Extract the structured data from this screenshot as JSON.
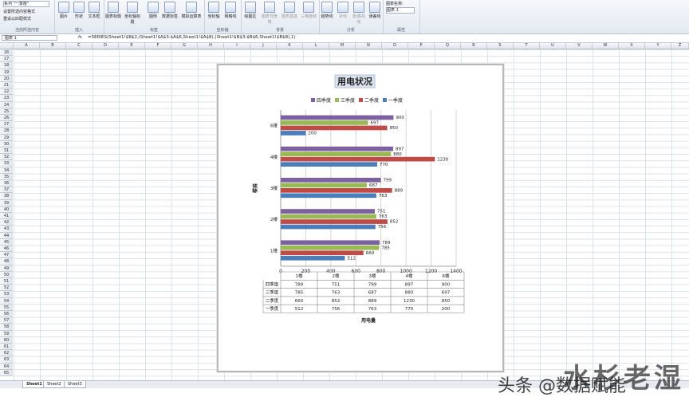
{
  "ribbon": {
    "series_selector": "系列 \"一季度\"",
    "format_selection": "设置所选内容格式",
    "reset_style": "重设以匹配样式",
    "group_current": "当前所选内容",
    "group_insert": "插入",
    "group_labels": "标签",
    "group_axes": "坐标轴",
    "group_background": "背景",
    "group_analysis": "分析",
    "group_properties": "属性",
    "buttons": [
      "图片",
      "形状",
      "文本框",
      "图表标题",
      "坐标轴标题",
      "图例",
      "数据标签",
      "模拟运算表",
      "坐标轴",
      "网格线",
      "绘图区",
      "图表背景墙",
      "图表基底",
      "三维旋转",
      "趋势线",
      "折线",
      "涨/跌柱线",
      "误差线"
    ],
    "chart_name_label": "图表名称:",
    "chart_name_value": "图表 1"
  },
  "formula_bar": {
    "name_box": "图表 1",
    "fx": "fx",
    "formula": "=SERIES(Sheet1!$B$2,(Sheet1!$A$3:$A$6,Sheet1!$A$8),(Sheet1!$B$3:$B$6,Sheet1!$B$8),1)"
  },
  "columns": [
    "A",
    "B",
    "C",
    "D",
    "E",
    "F",
    "G",
    "H",
    "I",
    "J",
    "K",
    "L",
    "M",
    "N",
    "O",
    "P",
    "Q",
    "R",
    "S",
    "T",
    "U",
    "V",
    "W",
    "X",
    "Y",
    "Z"
  ],
  "rows": [
    "16",
    "17",
    "18",
    "19",
    "20",
    "21",
    "22",
    "23",
    "24",
    "25",
    "26",
    "27",
    "28",
    "29",
    "30",
    "31",
    "32",
    "33",
    "34",
    "35",
    "36",
    "37",
    "38",
    "39",
    "40",
    "41",
    "42",
    "43",
    "44",
    "45",
    "46",
    "47",
    "48",
    "49",
    "50",
    "51",
    "52",
    "53",
    "54",
    "55",
    "56",
    "57",
    "58",
    "59",
    "60",
    "61",
    "62",
    "63",
    "64",
    "65"
  ],
  "sheets": [
    "Sheet1",
    "Sheet2",
    "Sheet3"
  ],
  "watermark": "头条 @数据赋能",
  "watermark2": "水杉老湿",
  "chart_data": {
    "type": "bar",
    "orientation": "horizontal",
    "title": "用电状况",
    "ylabel": "楼层",
    "xlabel": "用电量",
    "categories": [
      "1楼",
      "2楼",
      "3楼",
      "4楼",
      "6楼"
    ],
    "series": [
      {
        "name": "一季度",
        "color": "#4a7ebb",
        "values": [
          512,
          756,
          763,
          770,
          200
        ]
      },
      {
        "name": "二季度",
        "color": "#be4b48",
        "values": [
          660,
          852,
          889,
          1230,
          850
        ]
      },
      {
        "name": "三季度",
        "color": "#98b954",
        "values": [
          785,
          763,
          687,
          880,
          697
        ]
      },
      {
        "name": "四季度",
        "color": "#7d60a0",
        "values": [
          789,
          751,
          799,
          897,
          900
        ]
      }
    ],
    "legend_order": [
      "四季度",
      "三季度",
      "二季度",
      "一季度"
    ],
    "legend_position": "top",
    "xlim": [
      0,
      1400
    ],
    "xticks": [
      0,
      200,
      400,
      600,
      800,
      1000,
      1200,
      1400
    ],
    "grid": true,
    "data_table": {
      "headers": [
        "1楼",
        "2楼",
        "3楼",
        "4楼",
        "6楼"
      ],
      "rows": [
        {
          "label": "四季度",
          "values": [
            789,
            751,
            799,
            897,
            900
          ]
        },
        {
          "label": "三季度",
          "values": [
            785,
            763,
            687,
            880,
            697
          ]
        },
        {
          "label": "二季度",
          "values": [
            660,
            852,
            889,
            1230,
            850
          ]
        },
        {
          "label": "一季度",
          "values": [
            512,
            756,
            763,
            770,
            200
          ]
        }
      ]
    }
  }
}
